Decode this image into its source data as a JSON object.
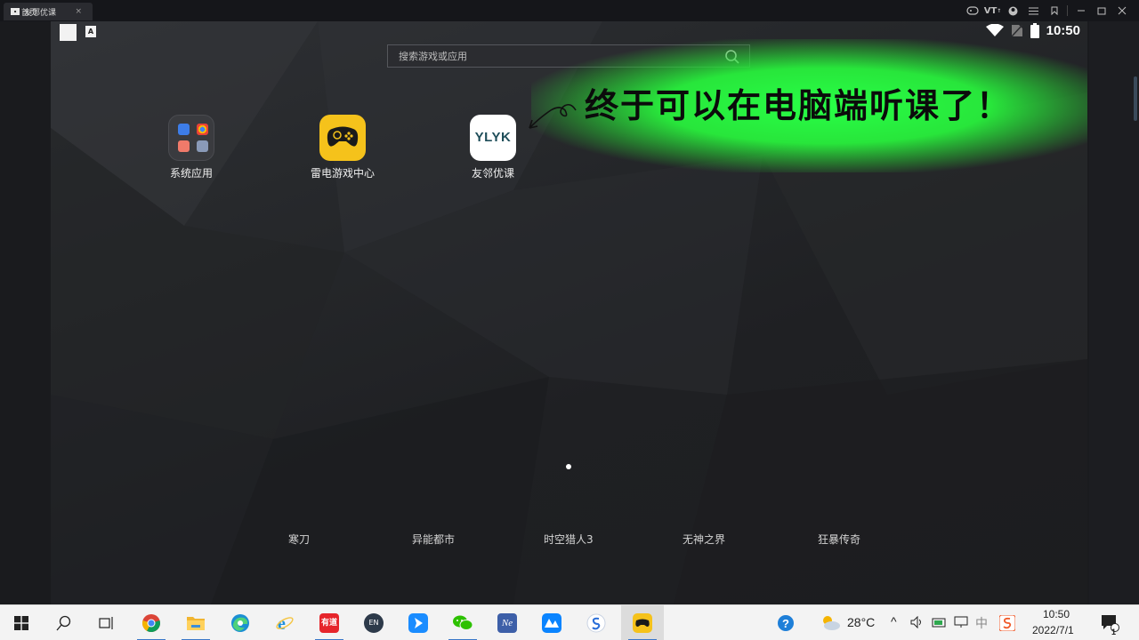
{
  "window": {
    "tabs": [
      {
        "label": "首页",
        "icon": "home-icon"
      },
      {
        "label": "友邻优课",
        "icon": "ylyk-tab-icon",
        "close": "×"
      }
    ],
    "controls": [
      "gamepad-icon",
      "vt-icon",
      "user-icon",
      "menu-icon",
      "pin-icon",
      "minimize-icon",
      "restore-icon",
      "close-icon"
    ],
    "vt_label": "VT"
  },
  "statusbar": {
    "left_icon_2_label": "A",
    "time": "10:50"
  },
  "search": {
    "placeholder": "搜索游戏或应用"
  },
  "callout": {
    "text": "终于可以在电脑端听课了！",
    "glow_color": "#28ff46"
  },
  "apps": [
    {
      "label": "系统应用",
      "icon": "system-apps-folder-icon"
    },
    {
      "label": "雷电游戏中心",
      "icon": "gamepad-icon"
    },
    {
      "label": "友邻优课",
      "icon_text": "YLYK"
    }
  ],
  "page_indicator": {
    "pages": 1,
    "current": 1
  },
  "dock": [
    "寒刀",
    "异能都市",
    "时空猎人3",
    "无神之界",
    "狂暴传奇"
  ],
  "taskbar": {
    "weather": "28°C",
    "ime": "中",
    "time": "10:50",
    "date": "2022/7/1",
    "notifications": "1",
    "pinned": [
      "chrome-icon",
      "file-explorer-icon",
      "edge-icon",
      "ie-icon",
      "youdao-icon",
      "en-icon",
      "feishu-icon",
      "wechat-icon",
      "ne-icon",
      "lark-icon",
      "sogou-icon",
      "ldplayer-icon"
    ],
    "youdao_label": "有道",
    "en_label": "EN",
    "ne_label": "Ne"
  }
}
